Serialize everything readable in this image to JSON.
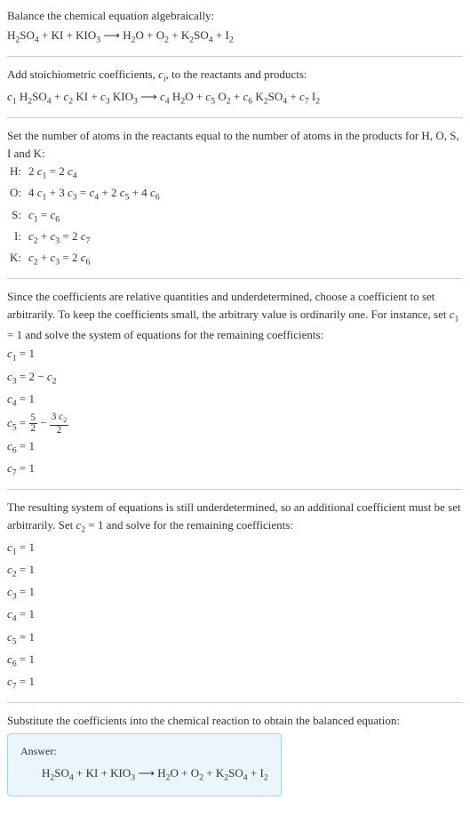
{
  "intro": {
    "title": "Balance the chemical equation algebraically:",
    "equation": "H₂SO₄ + KI + KIO₃ ⟶ H₂O + O₂ + K₂SO₄ + I₂"
  },
  "step2": {
    "title_before": "Add stoichiometric coefficients, ",
    "title_var": "c",
    "title_sub": "i",
    "title_after": ", to the reactants and products:",
    "equation": "c₁ H₂SO₄ + c₂ KI + c₃ KIO₃ ⟶ c₄ H₂O + c₅ O₂ + c₆ K₂SO₄ + c₇ I₂"
  },
  "step3": {
    "title": "Set the number of atoms in the reactants equal to the number of atoms in the products for H, O, S, I and K:",
    "rows": [
      {
        "label": "H:",
        "eq": "2 c₁ = 2 c₄"
      },
      {
        "label": "O:",
        "eq": "4 c₁ + 3 c₃ = c₄ + 2 c₅ + 4 c₆"
      },
      {
        "label": "S:",
        "eq": "c₁ = c₆"
      },
      {
        "label": "I:",
        "eq": "c₂ + c₃ = 2 c₇"
      },
      {
        "label": "K:",
        "eq": "c₂ + c₃ = 2 c₆"
      }
    ]
  },
  "step4": {
    "title": "Since the coefficients are relative quantities and underdetermined, choose a coefficient to set arbitrarily. To keep the coefficients small, the arbitrary value is ordinarily one. For instance, set c₁ = 1 and solve the system of equations for the remaining coefficients:",
    "rows": [
      "c₁ = 1",
      "c₃ = 2 − c₂",
      "c₄ = 1"
    ],
    "c5_prefix": "c₅ = ",
    "c5_frac1_num": "5",
    "c5_frac1_den": "2",
    "c5_minus": " − ",
    "c5_frac2_num": "3 c₂",
    "c5_frac2_den": "2",
    "rows2": [
      "c₆ = 1",
      "c₇ = 1"
    ]
  },
  "step5": {
    "title": "The resulting system of equations is still underdetermined, so an additional coefficient must be set arbitrarily. Set c₂ = 1 and solve for the remaining coefficients:",
    "rows": [
      "c₁ = 1",
      "c₂ = 1",
      "c₃ = 1",
      "c₄ = 1",
      "c₅ = 1",
      "c₆ = 1",
      "c₇ = 1"
    ]
  },
  "step6": {
    "title": "Substitute the coefficients into the chemical reaction to obtain the balanced equation:"
  },
  "answer": {
    "label": "Answer:",
    "equation": "H₂SO₄ + KI + KIO₃ ⟶ H₂O + O₂ + K₂SO₄ + I₂"
  },
  "chart_data": {
    "type": "table",
    "title": "Chemical equation balancing",
    "unbalanced_reaction": {
      "reactants": [
        "H2SO4",
        "KI",
        "KIO3"
      ],
      "products": [
        "H2O",
        "O2",
        "K2SO4",
        "I2"
      ]
    },
    "atom_balance_equations": {
      "H": "2c1 = 2c4",
      "O": "4c1 + 3c3 = c4 + 2c5 + 4c6",
      "S": "c1 = c6",
      "I": "c2 + c3 = 2c7",
      "K": "c2 + c3 = 2c6"
    },
    "partial_solution_c1_1": {
      "c1": 1,
      "c3": "2 - c2",
      "c4": 1,
      "c5": "5/2 - 3c2/2",
      "c6": 1,
      "c7": 1
    },
    "final_coefficients": {
      "c1": 1,
      "c2": 1,
      "c3": 1,
      "c4": 1,
      "c5": 1,
      "c6": 1,
      "c7": 1
    },
    "balanced_reaction": "H2SO4 + KI + KIO3 -> H2O + O2 + K2SO4 + I2"
  }
}
